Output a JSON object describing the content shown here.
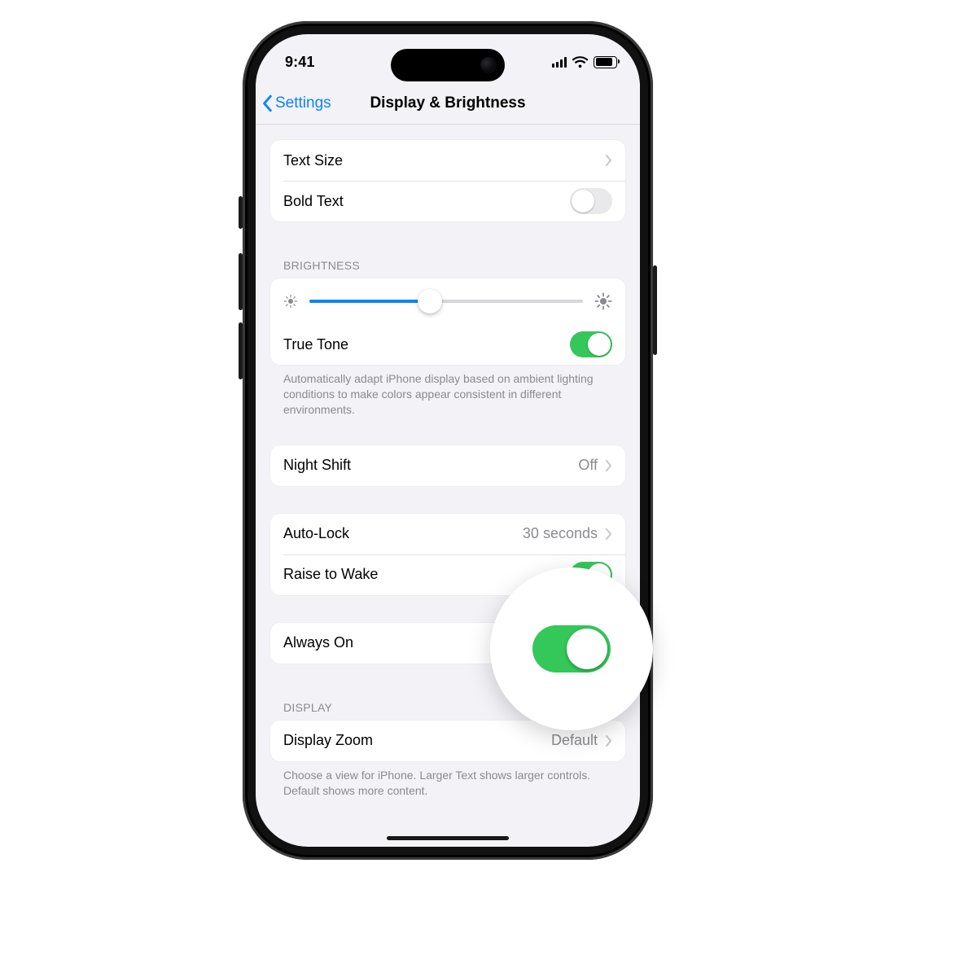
{
  "statusbar": {
    "time": "9:41"
  },
  "navbar": {
    "back_label": "Settings",
    "title": "Display & Brightness"
  },
  "text_group": {
    "text_size_label": "Text Size",
    "bold_text_label": "Bold Text",
    "bold_text_on": false
  },
  "brightness": {
    "header": "BRIGHTNESS",
    "level_percent": 44,
    "true_tone_label": "True Tone",
    "true_tone_on": true,
    "true_tone_footer": "Automatically adapt iPhone display based on ambient lighting conditions to make colors appear consistent in different environments."
  },
  "night_shift": {
    "label": "Night Shift",
    "value": "Off"
  },
  "autolock": {
    "label": "Auto-Lock",
    "value": "30 seconds"
  },
  "raise_to_wake": {
    "label": "Raise to Wake",
    "on": true
  },
  "always_on": {
    "label": "Always On",
    "on": true
  },
  "display": {
    "header": "DISPLAY",
    "zoom_label": "Display Zoom",
    "zoom_value": "Default",
    "zoom_footer": "Choose a view for iPhone. Larger Text shows larger controls. Default shows more content."
  }
}
